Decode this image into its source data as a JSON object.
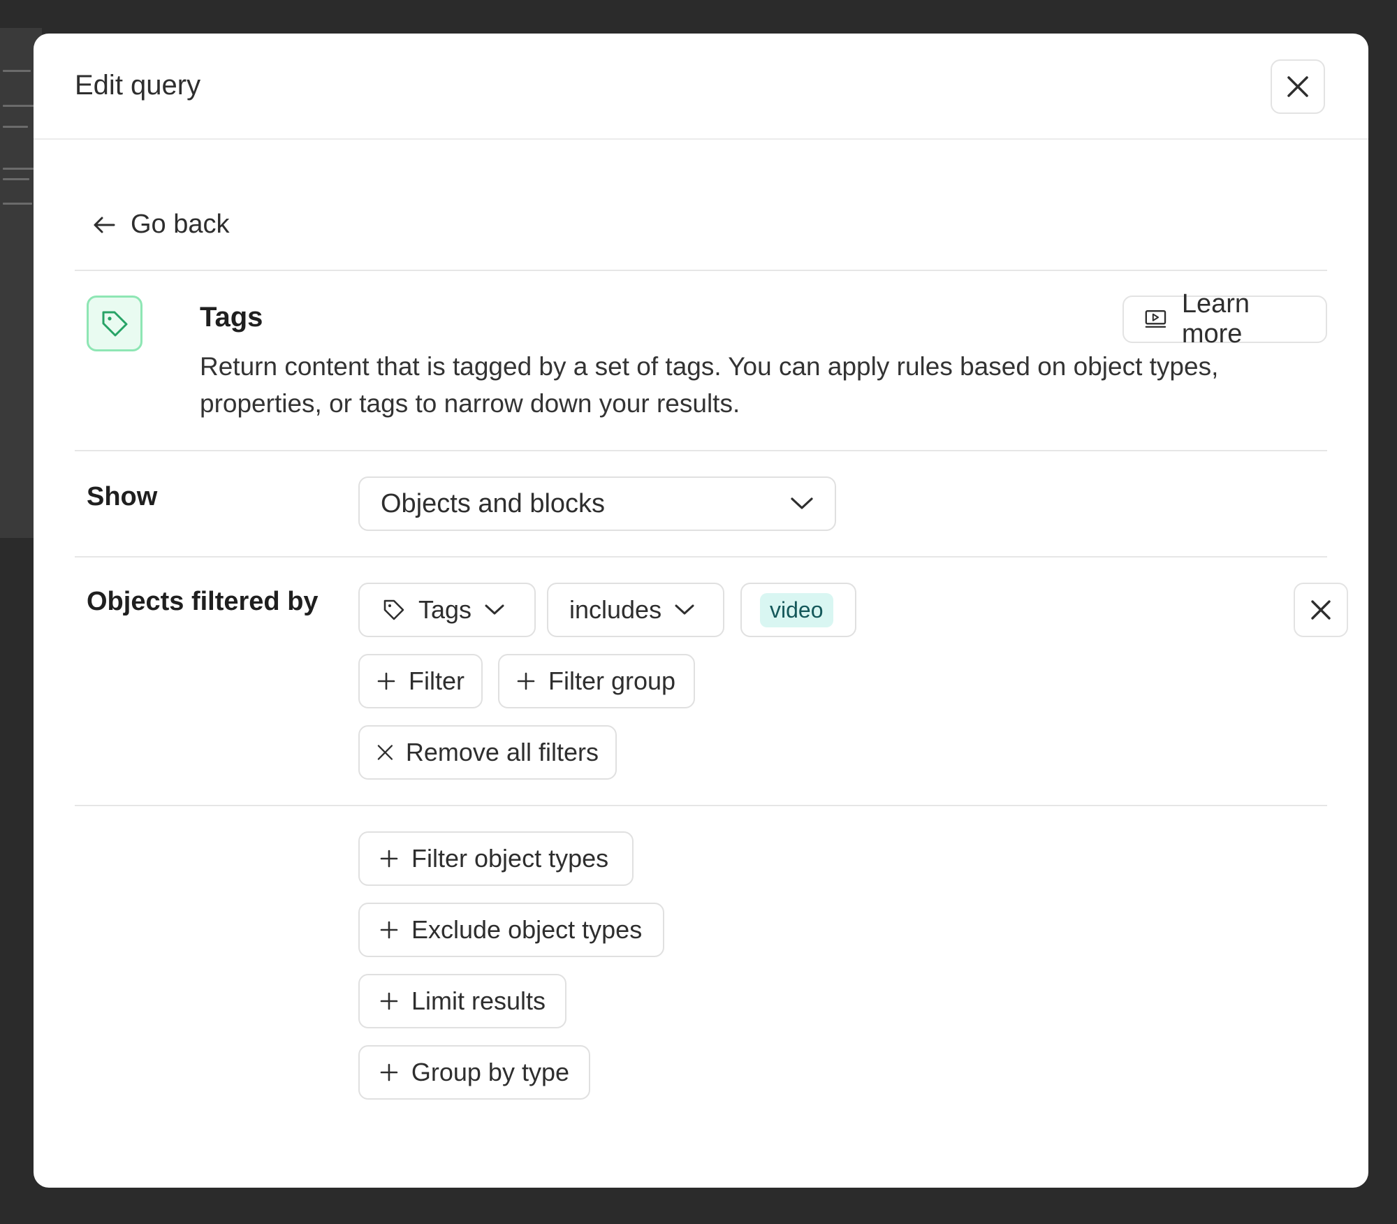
{
  "modal": {
    "title": "Edit query"
  },
  "nav": {
    "back_label": "Go back"
  },
  "info": {
    "title": "Tags",
    "description": "Return content that is tagged by a set of tags. You can apply rules based on object types, properties, or tags to narrow down your results.",
    "learn_more_label": "Learn more"
  },
  "show": {
    "label": "Show",
    "selected": "Objects and blocks"
  },
  "filters": {
    "label": "Objects filtered by",
    "field": "Tags",
    "operator": "includes",
    "value": "video",
    "add_filter_label": "Filter",
    "add_filter_group_label": "Filter group",
    "remove_all_label": "Remove all filters"
  },
  "options": {
    "filter_object_types": "Filter object types",
    "exclude_object_types": "Exclude object types",
    "limit_results": "Limit results",
    "group_by_type": "Group by type"
  },
  "colors": {
    "accent_green": "#27a366",
    "tag_bg": "#d9f6f2",
    "tag_text": "#14585a"
  }
}
